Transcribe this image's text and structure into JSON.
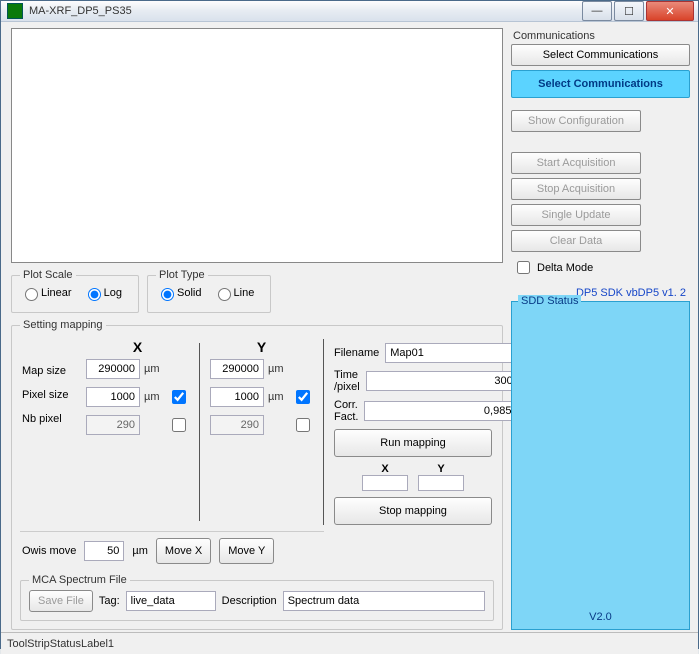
{
  "window": {
    "title": "MA-XRF_DP5_PS35"
  },
  "plotScale": {
    "legend": "Plot Scale",
    "linear": "Linear",
    "log": "Log",
    "selected": "Log"
  },
  "plotType": {
    "legend": "Plot Type",
    "solid": "Solid",
    "line": "Line",
    "selected": "Solid"
  },
  "setting": {
    "legend": "Setting mapping",
    "rowLabels": {
      "mapSize": "Map size",
      "pixelSize": "Pixel size",
      "nbPixel": "Nb pixel"
    },
    "xhead": "X",
    "yhead": "Y",
    "unit": "µm",
    "x": {
      "mapSize": "290000",
      "pixelSize": "1000",
      "nbPixel": "290",
      "cb": true
    },
    "y": {
      "mapSize": "290000",
      "pixelSize": "1000",
      "nbPixel": "290",
      "cb": true
    }
  },
  "owis": {
    "label": "Owis move",
    "value": "50",
    "unit": "µm",
    "moveX": "Move X",
    "moveY": "Move Y"
  },
  "run": {
    "filenameL": "Filename",
    "filename": "Map01",
    "timeL": "Time /pixel",
    "time": "300",
    "corrL": "Corr. Fact.",
    "corr": "0,985",
    "runBtn": "Run mapping",
    "stopBtn": "Stop mapping",
    "xL": "X",
    "yL": "Y",
    "xV": "",
    "yV": ""
  },
  "mca": {
    "legend": "MCA Spectrum File",
    "saveBtn": "Save File",
    "tagL": "Tag:",
    "tag": "live_data",
    "descL": "Description",
    "desc": "Spectrum data"
  },
  "right": {
    "commLegend": "Communications",
    "selectComm": "Select Communications",
    "selectCommBig": "Select Communications",
    "showConfig": "Show Configuration",
    "startAcq": "Start Acquisition",
    "stopAcq": "Stop Acquisition",
    "singleUpd": "Single Update",
    "clearData": "Clear Data",
    "deltaMode": "Delta Mode",
    "sdk": "DP5 SDK vbDP5 v1. 2",
    "sddLegend": "SDD Status",
    "version": "V2.0"
  },
  "status": "ToolStripStatusLabel1"
}
